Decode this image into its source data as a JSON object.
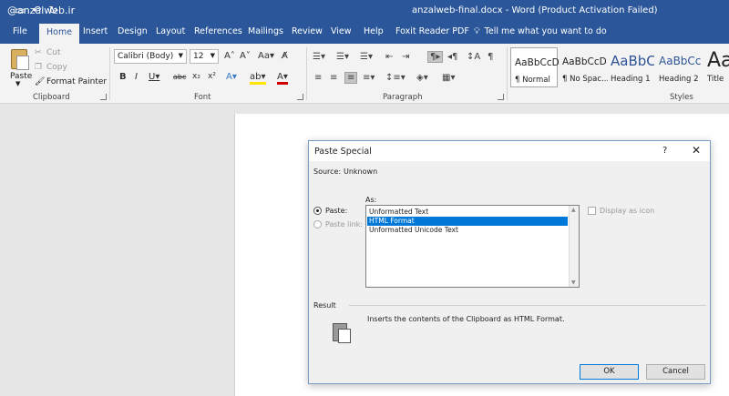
{
  "watermark": "@anzalweb.ir",
  "window": {
    "title": "anzalweb-final.docx - Word (Product Activation Failed)"
  },
  "tabs": [
    "File",
    "Home",
    "Insert",
    "Design",
    "Layout",
    "References",
    "Mailings",
    "Review",
    "View",
    "Help",
    "Foxit Reader PDF"
  ],
  "active_tab": "Home",
  "tell_me": "Tell me what you want to do",
  "clipboard": {
    "paste_label": "Paste",
    "cut_label": "Cut",
    "copy_label": "Copy",
    "format_painter_label": "Format Painter",
    "group_label": "Clipboard"
  },
  "font": {
    "family": "Calibri (Body)",
    "size": "12",
    "group_label": "Font"
  },
  "paragraph": {
    "group_label": "Paragraph"
  },
  "styles": {
    "group_label": "Styles",
    "items": [
      {
        "sample": "AaBbCcDc",
        "name": "¶ Normal"
      },
      {
        "sample": "AaBbCcDc",
        "name": "¶ No Spac..."
      },
      {
        "sample": "AaBbC",
        "name": "Heading 1"
      },
      {
        "sample": "AaBbCc",
        "name": "Heading 2"
      },
      {
        "sample": "Aa",
        "name": "Title"
      }
    ]
  },
  "dialog": {
    "title": "Paste Special",
    "help": "?",
    "close": "✕",
    "source_label": "Source:",
    "source_value": "Unknown",
    "as_label": "As:",
    "paste_label": "Paste:",
    "paste_link_label": "Paste link:",
    "formats": [
      "Unformatted Text",
      "HTML Format",
      "Unformatted Unicode Text"
    ],
    "selected_format": "HTML Format",
    "display_as_icon": "Display as icon",
    "result_label": "Result",
    "result_text": "Inserts the contents of the Clipboard as HTML Format.",
    "ok_label": "OK",
    "cancel_label": "Cancel"
  }
}
